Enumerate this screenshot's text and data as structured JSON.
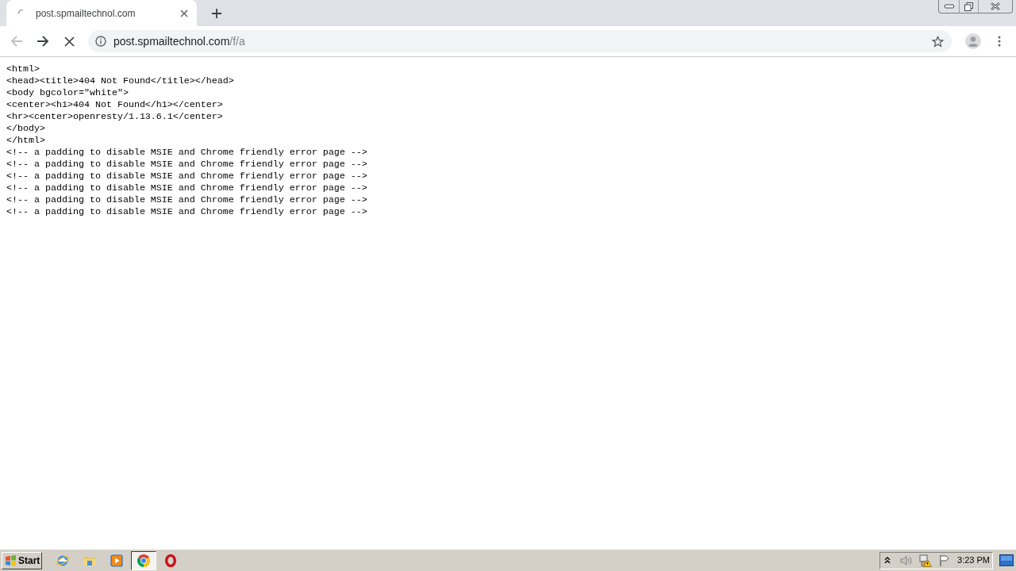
{
  "tabs": [
    {
      "title": "post.spmailtechnol.com",
      "selected": true,
      "loading": true
    }
  ],
  "toolbar": {
    "back": {
      "disabled": true
    },
    "forward": {
      "disabled": false
    },
    "loading": true
  },
  "address_bar": {
    "host": "post.spmailtechnol.com",
    "path": "/f/a"
  },
  "page": {
    "lines": [
      "<html>",
      "<head><title>404 Not Found</title></head>",
      "<body bgcolor=\"white\">",
      "<center><h1>404 Not Found</h1></center>",
      "<hr><center>openresty/1.13.6.1</center>",
      "</body>",
      "</html>",
      "<!-- a padding to disable MSIE and Chrome friendly error page -->",
      "<!-- a padding to disable MSIE and Chrome friendly error page -->",
      "<!-- a padding to disable MSIE and Chrome friendly error page -->",
      "<!-- a padding to disable MSIE and Chrome friendly error page -->",
      "<!-- a padding to disable MSIE and Chrome friendly error page -->",
      "<!-- a padding to disable MSIE and Chrome friendly error page -->"
    ]
  },
  "taskbar": {
    "start_label": "Start",
    "apps": [
      {
        "kind": "ie",
        "selected": false
      },
      {
        "kind": "explorer",
        "selected": false
      },
      {
        "kind": "media",
        "selected": false
      },
      {
        "kind": "chrome",
        "selected": true
      },
      {
        "kind": "opera",
        "selected": false
      }
    ],
    "clock": "3:23 PM"
  }
}
